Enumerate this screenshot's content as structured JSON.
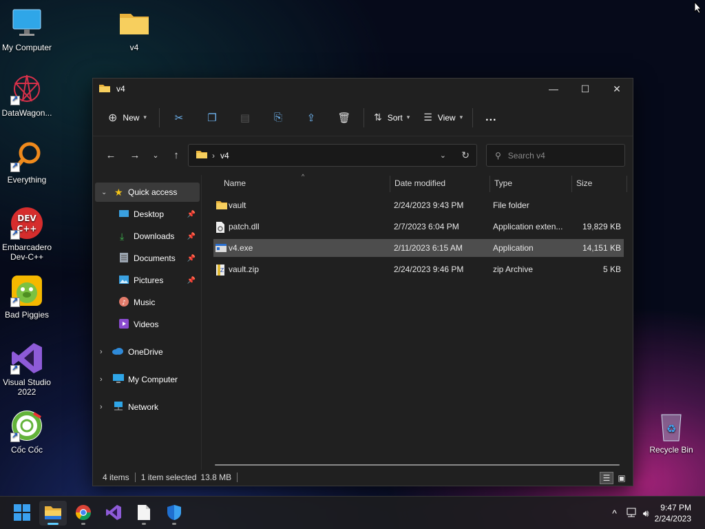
{
  "desktop": {
    "icons": [
      {
        "label": "My Computer"
      },
      {
        "label": "v4"
      },
      {
        "label": "DataWagon..."
      },
      {
        "label": "Everything"
      },
      {
        "label": "Embarcadero Dev-C++"
      },
      {
        "label": "Bad Piggies"
      },
      {
        "label": "Visual Studio 2022"
      },
      {
        "label": "Cốc Cốc"
      },
      {
        "label": "Recycle Bin"
      }
    ]
  },
  "window": {
    "title": "v4",
    "toolbar": {
      "new_label": "New",
      "sort_label": "Sort",
      "view_label": "View",
      "more_label": "..."
    },
    "address": {
      "path_sep": "›",
      "current": "v4"
    },
    "search": {
      "placeholder": "Search v4"
    },
    "nav": {
      "quick_access": "Quick access",
      "items": [
        {
          "label": "Desktop",
          "pinned": true
        },
        {
          "label": "Downloads",
          "pinned": true
        },
        {
          "label": "Documents",
          "pinned": true
        },
        {
          "label": "Pictures",
          "pinned": true
        },
        {
          "label": "Music",
          "pinned": false
        },
        {
          "label": "Videos",
          "pinned": false
        }
      ],
      "roots": [
        {
          "label": "OneDrive"
        },
        {
          "label": "My Computer"
        },
        {
          "label": "Network"
        }
      ]
    },
    "columns": {
      "name": "Name",
      "date": "Date modified",
      "type": "Type",
      "size": "Size"
    },
    "files": [
      {
        "name": "vault",
        "date": "2/24/2023 9:43 PM",
        "type": "File folder",
        "size": "",
        "icon": "folder-icon",
        "selected": false
      },
      {
        "name": "patch.dll",
        "date": "2/7/2023 6:04 PM",
        "type": "Application exten...",
        "size": "19,829 KB",
        "icon": "dll-file-icon",
        "selected": false
      },
      {
        "name": "v4.exe",
        "date": "2/11/2023 6:15 AM",
        "type": "Application",
        "size": "14,151 KB",
        "icon": "exe-file-icon",
        "selected": true
      },
      {
        "name": "vault.zip",
        "date": "2/24/2023 9:46 PM",
        "type": "zip Archive",
        "size": "5 KB",
        "icon": "zip-file-icon",
        "selected": false
      }
    ],
    "status": {
      "count": "4 items",
      "selected": "1 item selected",
      "size": "13.8 MB"
    }
  },
  "taskbar": {
    "clock_time": "9:47 PM",
    "clock_date": "2/24/2023"
  },
  "colors": {
    "accent": "#60cdff",
    "folder": "#f4c54a",
    "selected_row": "#4d4d4d"
  }
}
